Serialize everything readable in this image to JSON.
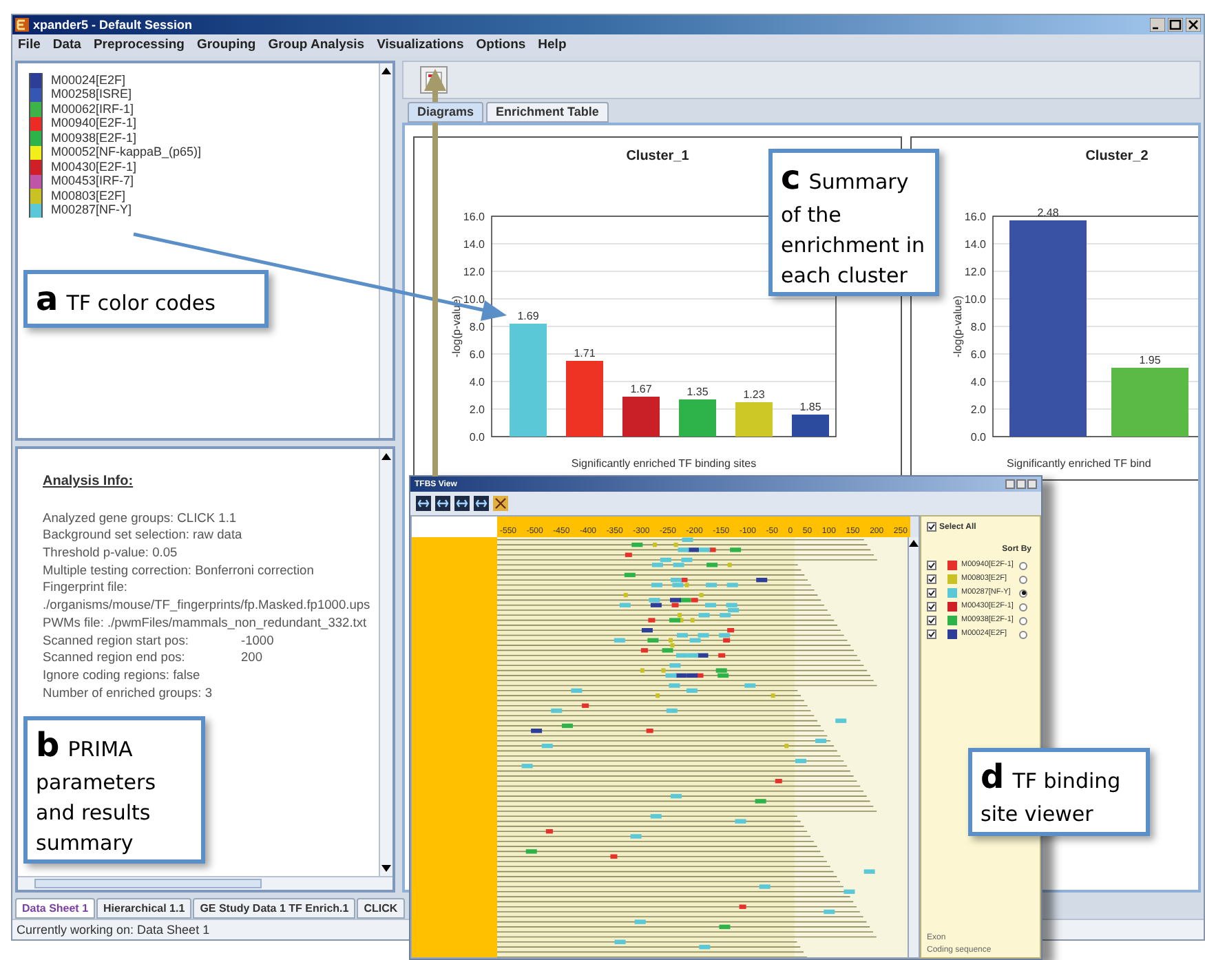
{
  "window": {
    "title": "xpander5 - Default Session"
  },
  "menu": [
    "File",
    "Data",
    "Preprocessing",
    "Grouping",
    "Group Analysis",
    "Visualizations",
    "Options",
    "Help"
  ],
  "tf_legend": [
    {
      "name": "M00024[E2F]",
      "color": "#2c3e98"
    },
    {
      "name": "M00258[ISRE]",
      "color": "#3557b3"
    },
    {
      "name": "M00062[IRF-1]",
      "color": "#3cb44a"
    },
    {
      "name": "M00940[E2F-1]",
      "color": "#ee2a24"
    },
    {
      "name": "M00938[E2F-1]",
      "color": "#2db34a"
    },
    {
      "name": "M00052[NF-kappaB_(p65)]",
      "color": "#f2ee1c"
    },
    {
      "name": "M00430[E2F-1]",
      "color": "#cf2027"
    },
    {
      "name": "M00453[IRF-7]",
      "color": "#c055a8"
    },
    {
      "name": "M00803[E2F]",
      "color": "#c8c224"
    },
    {
      "name": "M00287[NF-Y]",
      "color": "#5bc8d8"
    }
  ],
  "analysis_info": {
    "heading": "Analysis Info:",
    "lines": [
      {
        "text": "Analyzed gene groups: CLICK 1.1"
      },
      {
        "text": "Background set selection: raw data"
      },
      {
        "text": "Threshold p-value: 0.05"
      },
      {
        "text": "Multiple testing correction: Bonferroni correction"
      },
      {
        "text": "Fingerprint file:"
      },
      {
        "text": "./organisms/mouse/TF_fingerprints/fp.Masked.fp1000.ups"
      },
      {
        "text": "PWMs file:  ./pwmFiles/mammals_non_redundant_332.txt"
      },
      {
        "text": "Scanned region start pos:",
        "value": "-1000"
      },
      {
        "text": "Scanned region end pos:",
        "value": "200"
      },
      {
        "text": "Ignore coding regions: false"
      },
      {
        "text": "Number of enriched groups: 3"
      }
    ]
  },
  "right_tabs": [
    {
      "label": "Diagrams",
      "selected": true
    },
    {
      "label": "Enrichment Table",
      "selected": false
    }
  ],
  "charts": [
    {
      "chart_data": {
        "type": "bar",
        "title": "Cluster_1",
        "xlabel": "Significantly enriched TF binding sites",
        "ylabel": "-log(p-value)",
        "ylim": [
          0,
          16
        ],
        "yticks": [
          {
            "value": 16,
            "label": "16.0"
          },
          {
            "value": 14,
            "label": "14.0"
          },
          {
            "value": 12,
            "label": "12.0"
          },
          {
            "value": 10,
            "label": "10.0"
          },
          {
            "value": 8,
            "label": "8.0"
          },
          {
            "value": 6,
            "label": "6.0"
          },
          {
            "value": 4,
            "label": "4.0"
          },
          {
            "value": 2,
            "label": "2.0"
          },
          {
            "value": 0,
            "label": "0.0"
          }
        ],
        "grid": true,
        "stacked": true,
        "series": [
          {
            "color": "#5bc8d8",
            "values": [
              8.2,
              null,
              null,
              null,
              null,
              null
            ]
          },
          {
            "color": "#ee3224",
            "values": [
              null,
              5.5,
              null,
              null,
              null,
              null
            ]
          },
          {
            "color": "#c82026",
            "values": [
              null,
              null,
              2.9,
              null,
              null,
              null
            ]
          },
          {
            "color": "#2db34a",
            "values": [
              null,
              null,
              null,
              2.7,
              null,
              null
            ]
          },
          {
            "color": "#cdc826",
            "values": [
              null,
              null,
              null,
              null,
              2.5,
              null
            ]
          },
          {
            "color": "#2c4a9e",
            "values": [
              null,
              null,
              null,
              null,
              null,
              1.6
            ]
          }
        ],
        "value_labels": [
          "1.69",
          "1.71",
          "1.67",
          "1.35",
          "1.23",
          "1.85"
        ]
      }
    },
    {
      "chart_data": {
        "type": "bar",
        "title": "Cluster_2",
        "xlabel": "Significantly enriched TF bind",
        "ylabel": "-log(p-value)",
        "ylim": [
          0,
          16
        ],
        "yticks": [
          {
            "value": 16,
            "label": "16.0"
          },
          {
            "value": 14,
            "label": "14.0"
          },
          {
            "value": 12,
            "label": "12.0"
          },
          {
            "value": 10,
            "label": "10.0"
          },
          {
            "value": 8,
            "label": "8.0"
          },
          {
            "value": 6,
            "label": "6.0"
          },
          {
            "value": 4,
            "label": "4.0"
          },
          {
            "value": 2,
            "label": "2.0"
          },
          {
            "value": 0,
            "label": "0.0"
          }
        ],
        "grid": true,
        "stacked": true,
        "series": [
          {
            "color": "#3a52a4",
            "values": [
              15.7,
              null
            ]
          },
          {
            "color": "#5bb946",
            "values": [
              null,
              5.0
            ]
          }
        ],
        "value_labels": [
          "2.48",
          "1.95"
        ]
      }
    }
  ],
  "bottom_tabs": [
    {
      "label": "Data Sheet 1",
      "selected": true
    },
    {
      "label": "Hierarchical 1.1",
      "selected": false
    },
    {
      "label": "GE Study Data 1 TF Enrich.1",
      "selected": false
    },
    {
      "label": "CLICK",
      "selected": false
    }
  ],
  "status_bar": "Currently working on: Data Sheet 1",
  "tfbs_view": {
    "title": "TFBS View",
    "axis_ticks": [
      "-550",
      "-500",
      "-450",
      "-400",
      "-350",
      "-300",
      "-250",
      "-200",
      "-150",
      "-100",
      "-50",
      "0",
      "50",
      "100",
      "150",
      "200",
      "250"
    ],
    "select_all": {
      "label": "Select All",
      "checked": true
    },
    "sort_by": "Sort By",
    "motifs": [
      {
        "name": "M00940[E2F-1]",
        "color": "#e8302a",
        "checked": true,
        "selected": false
      },
      {
        "name": "M00803[E2F]",
        "color": "#c8c224",
        "checked": true,
        "selected": false
      },
      {
        "name": "M00287[NF-Y]",
        "color": "#5bc8d8",
        "checked": true,
        "selected": true
      },
      {
        "name": "M00430[E2F-1]",
        "color": "#cf2027",
        "checked": true,
        "selected": false
      },
      {
        "name": "M00938[E2F-1]",
        "color": "#2db34a",
        "checked": true,
        "selected": false
      },
      {
        "name": "M00024[E2F]",
        "color": "#2c3e98",
        "checked": true,
        "selected": false
      }
    ],
    "footer": [
      "Exon",
      "Coding sequence"
    ]
  },
  "callouts": [
    {
      "letter": "a",
      "text": "TF color codes"
    },
    {
      "letter": "b",
      "text": "PRIMA parameters and results summary"
    },
    {
      "letter": "c",
      "text": "Summary of the enrichment in each cluster"
    },
    {
      "letter": "d",
      "text": "TF binding site viewer"
    }
  ]
}
